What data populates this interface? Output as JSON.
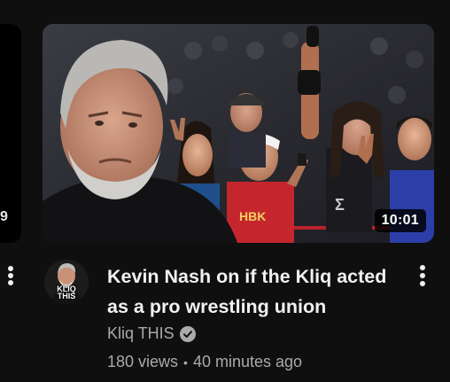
{
  "previous_video": {
    "duration": "9"
  },
  "video": {
    "duration": "10:01",
    "title": "Kevin Nash on if the Kliq acted as a pro wrestling union",
    "channel": "Kliq THIS",
    "views": "180 views",
    "separator": "•",
    "age": "40 minutes ago",
    "thumbnail_icon": "wrestlers-photo-thumbnail",
    "verified_icon": "verified-check-icon",
    "menu_icon": "more-vert-icon"
  },
  "avatar": {
    "line1": "KLIQ",
    "line2": "THIS"
  },
  "colors": {
    "background": "#0f0f0f",
    "title_text": "#f1f1f1",
    "secondary_text": "#aaaaaa",
    "duration_badge": "#000000"
  }
}
